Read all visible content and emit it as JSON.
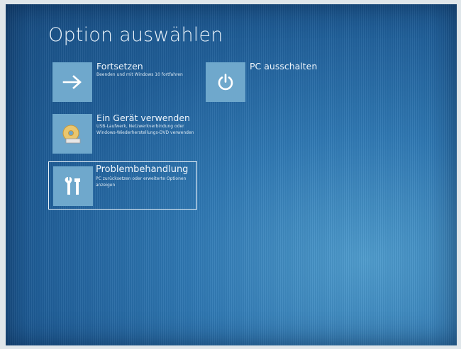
{
  "page": {
    "title": "Option auswählen"
  },
  "options": [
    {
      "label": "Fortsetzen",
      "description": "Beenden und mit Windows 10 fortfahren",
      "icon": "arrow-right-icon"
    },
    {
      "label": "Ein Gerät verwenden",
      "description": "USB-Laufwerk, Netzwerkverbindung oder Windows-Wiederherstellungs-DVD verwenden",
      "icon": "disc-device-icon"
    },
    {
      "label": "Problembehandlung",
      "description": "PC zurücksetzen oder erweiterte Optionen anzeigen",
      "icon": "tools-icon",
      "selected": true
    },
    {
      "label": "PC ausschalten",
      "icon": "power-icon"
    }
  ],
  "colors": {
    "background": "#1f5e98",
    "tile": "#6fa8cc",
    "text": "#eef5fb"
  }
}
